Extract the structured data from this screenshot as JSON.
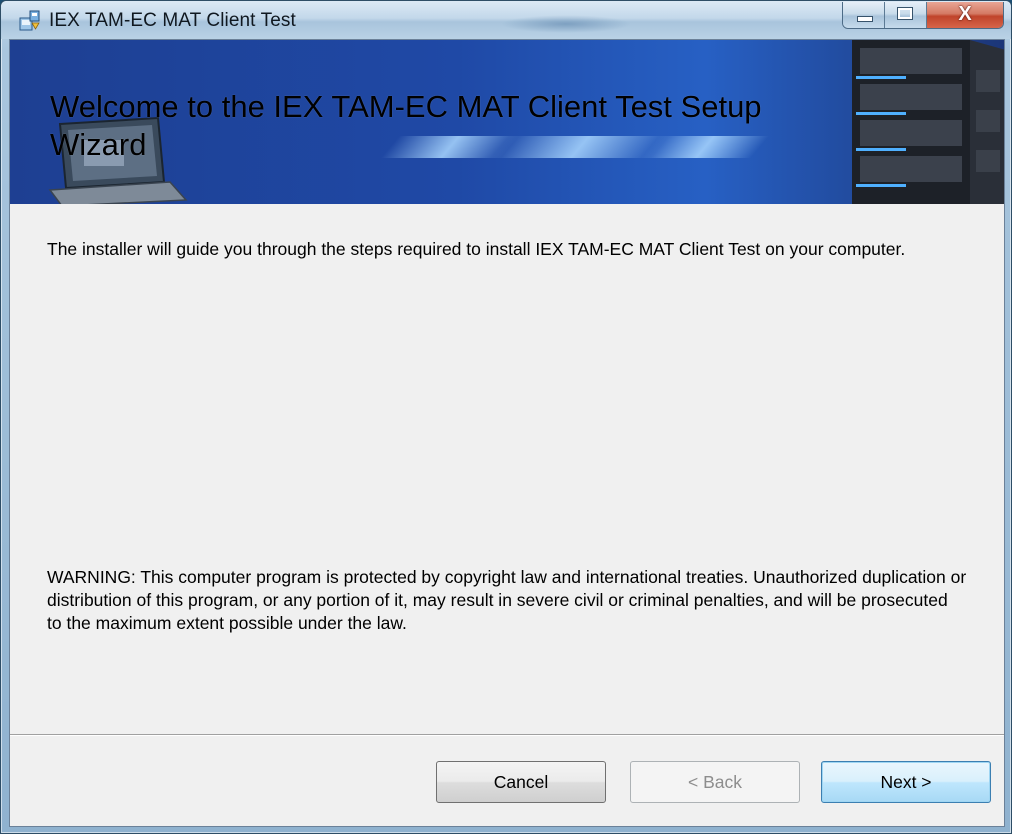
{
  "window": {
    "title": "IEX TAM-EC MAT Client Test",
    "icons": {
      "app": "installer-icon",
      "minimize": "minimize-icon",
      "maximize": "maximize-icon",
      "close": "close-icon"
    },
    "close_glyph": "X"
  },
  "banner": {
    "title": "Welcome to the IEX TAM-EC MAT Client Test Setup Wizard",
    "images": [
      "laptop-graphic",
      "server-rack-graphic"
    ]
  },
  "content": {
    "intro": "The installer will guide you through the steps required to install IEX TAM-EC MAT Client Test on your computer.",
    "warning": "WARNING: This computer program is protected by copyright law and international treaties. Unauthorized duplication or distribution of this program, or any portion of it, may result in severe civil or criminal penalties, and will be prosecuted to the maximum extent possible under the law."
  },
  "buttons": {
    "cancel": "Cancel",
    "back": "< Back",
    "next": "Next >",
    "back_enabled": false,
    "default_button": "next"
  },
  "colors": {
    "banner_blue": "#1f49a6",
    "dialog_face": "#f0f0f0",
    "close_red": "#c0442b",
    "default_button_border": "#3c7fb1"
  }
}
